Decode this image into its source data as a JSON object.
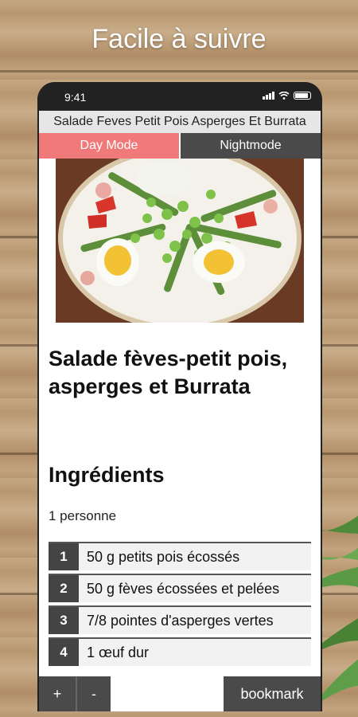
{
  "promo": {
    "title": "Facile à suivre"
  },
  "status_bar": {
    "time": "9:41"
  },
  "app": {
    "title": "Salade Feves Petit Pois Asperges Et Burrata",
    "day_mode_label": "Day Mode",
    "night_mode_label": "Nightmode"
  },
  "recipe": {
    "image_alt": "Salade fèves-petit pois, asperges et Burrata",
    "title": "Salade fèves-petit pois, asperges et Burrata",
    "ingredients_heading": "Ingrédients",
    "servings": "1 personne",
    "ingredients": [
      {
        "num": "1",
        "text": "50 g petits pois écossés"
      },
      {
        "num": "2",
        "text": "50 g fèves écossées et pelées"
      },
      {
        "num": "3",
        "text": "7/8 pointes d'asperges vertes"
      },
      {
        "num": "4",
        "text": "1 œuf dur"
      }
    ]
  },
  "bottom_bar": {
    "plus": "+",
    "minus": "-",
    "bookmark": "bookmark"
  },
  "colors": {
    "day_mode": "#f07a7a",
    "dark_button": "#4a4a4a",
    "plate_bg": "#6a3a24"
  }
}
